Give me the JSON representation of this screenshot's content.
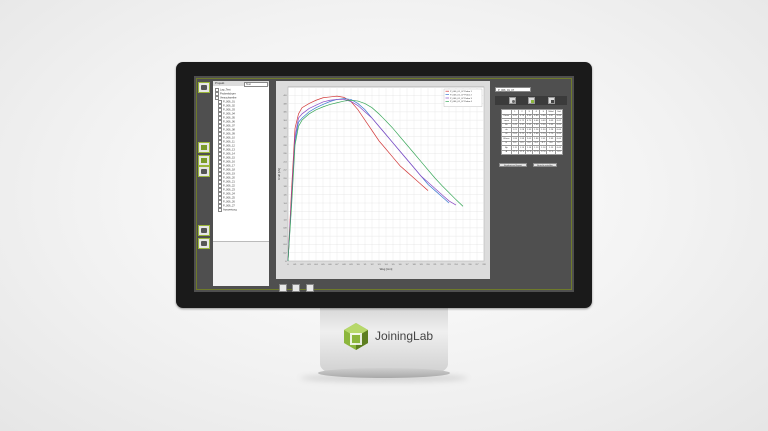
{
  "brand": {
    "name": "JoiningLab",
    "accent": "#8cb63c",
    "accent_dark": "#5e7f20"
  },
  "tree": {
    "header_label": "Projekt",
    "dropdown_value": "Test",
    "items": [
      "Lap_Test",
      "Probenkörper",
      "Versuchsreihe",
      "P_006_01",
      "P_006_02",
      "P_006_03",
      "P_006_04",
      "P_006_05",
      "P_006_06",
      "P_006_07",
      "P_006_08",
      "P_006_09",
      "P_006_10",
      "P_006_11",
      "P_006_12",
      "P_006_13",
      "P_006_14",
      "P_006_15",
      "P_006_16",
      "P_006_17",
      "P_006_18",
      "P_006_19",
      "P_006_20",
      "P_006_21",
      "P_006_22",
      "P_006_23",
      "P_006_24",
      "P_006_25",
      "P_006_26",
      "P_006_27",
      "Auswertung"
    ]
  },
  "right": {
    "dropdown_value": "P_006_01_07",
    "table": {
      "header": [
        "",
        "1",
        "2",
        "3",
        "4",
        "5",
        "Mittel",
        "Std"
      ],
      "rows": [
        [
          "Fmax",
          "3.91",
          "3.76",
          "3.95",
          "3.85",
          "3.88",
          "3.87",
          "0.06"
        ],
        [
          "smax",
          "0.68",
          "0.72",
          "0.70",
          "0.66",
          "0.69",
          "0.69",
          "0.02"
        ],
        [
          "Fb",
          "2.41",
          "2.37",
          "2.52",
          "2.45",
          "2.39",
          "2.43",
          "0.05"
        ],
        [
          "sb",
          "1.21",
          "1.28",
          "1.33",
          "1.26",
          "1.30",
          "1.28",
          "0.04"
        ],
        [
          "W",
          "2.61",
          "2.71",
          "2.76",
          "2.68",
          "2.73",
          "2.70",
          "0.05"
        ],
        [
          "Wmax",
          "1.93",
          "1.99",
          "2.05",
          "1.96",
          "2.01",
          "1.99",
          "0.04"
        ],
        [
          "E",
          "8.3",
          "8.9",
          "8.6",
          "8.4",
          "8.7",
          "8.6",
          "0.2"
        ],
        [
          "Rp",
          "1.11",
          "1.15",
          "1.18",
          "1.13",
          "1.16",
          "1.15",
          "0.03"
        ],
        [
          "A",
          "17.1",
          "17.5",
          "17.9",
          "17.3",
          "17.6",
          "17.5",
          "0.3"
        ]
      ]
    },
    "btn_export": "Ergebnisse Export",
    "btn_report": "Bericht erstellen"
  },
  "chart_data": {
    "type": "line",
    "title": "",
    "xlabel": "Weg [mm]",
    "ylabel": "Kraft [kN]",
    "xlim": [
      0,
      2.8
    ],
    "ylim": [
      0,
      4.2
    ],
    "x_ticks": [
      "0",
      "0.1",
      "0.2",
      "0.3",
      "0.4",
      "0.5",
      "0.6",
      "0.7",
      "0.8",
      "0.9",
      "1.0",
      "1.1",
      "1.2",
      "1.3",
      "1.4",
      "1.5",
      "1.6",
      "1.7",
      "1.8",
      "1.9",
      "2.0",
      "2.1",
      "2.2",
      "2.3",
      "2.4",
      "2.5",
      "2.6",
      "2.7",
      "2.8"
    ],
    "y_ticks": [
      "0",
      "0.2",
      "0.4",
      "0.6",
      "0.8",
      "1.0",
      "1.2",
      "1.4",
      "1.6",
      "1.8",
      "2.0",
      "2.2",
      "2.4",
      "2.6",
      "2.8",
      "3.0",
      "3.2",
      "3.4",
      "3.6",
      "3.8",
      "4.0"
    ],
    "legend_position": "top-right",
    "series": [
      {
        "name": "P_006_01_07 Probe 1",
        "color": "#d23a3a",
        "x": [
          0,
          0.05,
          0.1,
          0.15,
          0.2,
          0.3,
          0.4,
          0.5,
          0.6,
          0.7,
          0.8,
          0.9,
          1.0,
          1.1,
          1.2,
          1.3,
          1.4,
          1.5,
          1.6,
          1.7,
          1.8,
          1.9,
          2.0
        ],
        "y": [
          0,
          1.7,
          3.2,
          3.55,
          3.7,
          3.8,
          3.88,
          3.94,
          3.96,
          3.98,
          3.95,
          3.85,
          3.65,
          3.4,
          3.15,
          2.9,
          2.7,
          2.5,
          2.3,
          2.15,
          2.0,
          1.85,
          1.7
        ]
      },
      {
        "name": "P_006_01_07 Probe 2",
        "color": "#3a7bd0",
        "x": [
          0,
          0.05,
          0.1,
          0.15,
          0.2,
          0.3,
          0.4,
          0.5,
          0.6,
          0.7,
          0.8,
          0.9,
          1.0,
          1.1,
          1.2,
          1.3,
          1.4,
          1.5,
          1.6,
          1.7,
          1.8,
          1.9,
          2.0,
          2.1,
          2.2,
          2.3
        ],
        "y": [
          0,
          1.4,
          2.9,
          3.35,
          3.45,
          3.6,
          3.7,
          3.78,
          3.85,
          3.9,
          3.92,
          3.9,
          3.8,
          3.65,
          3.45,
          3.25,
          3.05,
          2.85,
          2.65,
          2.45,
          2.25,
          2.05,
          1.85,
          1.7,
          1.55,
          1.4
        ]
      },
      {
        "name": "P_006_01_07 Probe 3",
        "color": "#8a4ac4",
        "x": [
          0,
          0.05,
          0.1,
          0.15,
          0.2,
          0.3,
          0.4,
          0.5,
          0.6,
          0.7,
          0.8,
          0.9,
          1.0,
          1.1,
          1.2,
          1.3,
          1.4,
          1.5,
          1.6,
          1.7,
          1.8,
          1.9,
          2.0,
          2.1,
          2.2,
          2.3,
          2.4
        ],
        "y": [
          0,
          1.5,
          3.0,
          3.45,
          3.55,
          3.68,
          3.76,
          3.84,
          3.88,
          3.9,
          3.9,
          3.85,
          3.75,
          3.6,
          3.45,
          3.25,
          3.05,
          2.85,
          2.65,
          2.45,
          2.25,
          2.05,
          1.9,
          1.75,
          1.6,
          1.45,
          1.35
        ]
      },
      {
        "name": "P_006_01_07 Probe 4",
        "color": "#3aa85a",
        "x": [
          0,
          0.05,
          0.1,
          0.15,
          0.2,
          0.3,
          0.4,
          0.5,
          0.6,
          0.7,
          0.8,
          0.9,
          1.0,
          1.1,
          1.2,
          1.3,
          1.4,
          1.5,
          1.6,
          1.7,
          1.8,
          1.9,
          2.0,
          2.1,
          2.2,
          2.3,
          2.4,
          2.5
        ],
        "y": [
          0,
          1.3,
          2.8,
          3.25,
          3.4,
          3.55,
          3.65,
          3.72,
          3.78,
          3.82,
          3.86,
          3.88,
          3.86,
          3.8,
          3.7,
          3.55,
          3.38,
          3.2,
          3.0,
          2.8,
          2.6,
          2.4,
          2.2,
          2.0,
          1.82,
          1.65,
          1.48,
          1.32
        ]
      }
    ]
  }
}
